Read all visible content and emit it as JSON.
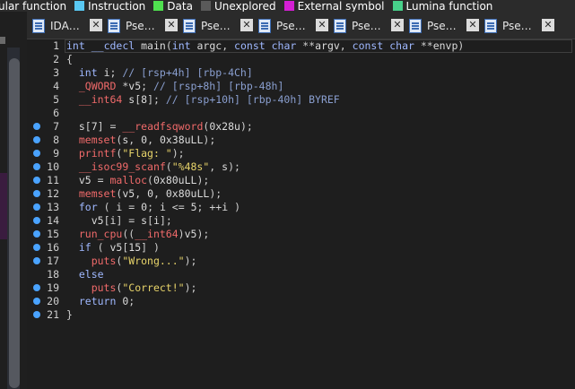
{
  "legend": {
    "items": [
      {
        "label": "ular function",
        "color": "#1a1a1a"
      },
      {
        "label": "Instruction",
        "color": "#59c8f2"
      },
      {
        "label": "Data",
        "color": "#4fe04f"
      },
      {
        "label": "Unexplored",
        "color": "#5a5a5a"
      },
      {
        "label": "External symbol",
        "color": "#d41fd4"
      },
      {
        "label": "Lumina function",
        "color": "#47d08a"
      }
    ]
  },
  "tabs": [
    {
      "label": "IDA…"
    },
    {
      "label": "Pse…"
    },
    {
      "label": "Pse…"
    },
    {
      "label": "Pse…"
    },
    {
      "label": "Pse…"
    },
    {
      "label": "Pse…"
    },
    {
      "label": "Pse…"
    }
  ],
  "code": {
    "lines": [
      {
        "num": "1",
        "bp": false,
        "text": "int __cdecl main(int argc, const char **argv, const char **envp)"
      },
      {
        "num": "2",
        "bp": false,
        "text": "{"
      },
      {
        "num": "3",
        "bp": false,
        "text": "  int i; // [rsp+4h] [rbp-4Ch]"
      },
      {
        "num": "4",
        "bp": false,
        "text": "  _QWORD *v5; // [rsp+8h] [rbp-48h]"
      },
      {
        "num": "5",
        "bp": false,
        "text": "  __int64 s[8]; // [rsp+10h] [rbp-40h] BYREF"
      },
      {
        "num": "6",
        "bp": false,
        "text": ""
      },
      {
        "num": "7",
        "bp": true,
        "text": "  s[7] = __readfsqword(0x28u);"
      },
      {
        "num": "8",
        "bp": true,
        "text": "  memset(s, 0, 0x38uLL);"
      },
      {
        "num": "9",
        "bp": true,
        "text": "  printf(\"Flag: \");"
      },
      {
        "num": "10",
        "bp": true,
        "text": "  __isoc99_scanf(\"%48s\", s);"
      },
      {
        "num": "11",
        "bp": true,
        "text": "  v5 = malloc(0x80uLL);"
      },
      {
        "num": "12",
        "bp": true,
        "text": "  memset(v5, 0, 0x80uLL);"
      },
      {
        "num": "13",
        "bp": true,
        "text": "  for ( i = 0; i <= 5; ++i )"
      },
      {
        "num": "14",
        "bp": true,
        "text": "    v5[i] = s[i];"
      },
      {
        "num": "15",
        "bp": true,
        "text": "  run_cpu((__int64)v5);"
      },
      {
        "num": "16",
        "bp": true,
        "text": "  if ( v5[15] )"
      },
      {
        "num": "17",
        "bp": true,
        "text": "    puts(\"Wrong...\");"
      },
      {
        "num": "18",
        "bp": false,
        "text": "  else"
      },
      {
        "num": "19",
        "bp": true,
        "text": "    puts(\"Correct!\");"
      },
      {
        "num": "20",
        "bp": true,
        "text": "  return 0;"
      },
      {
        "num": "21",
        "bp": true,
        "text": "}"
      }
    ]
  }
}
